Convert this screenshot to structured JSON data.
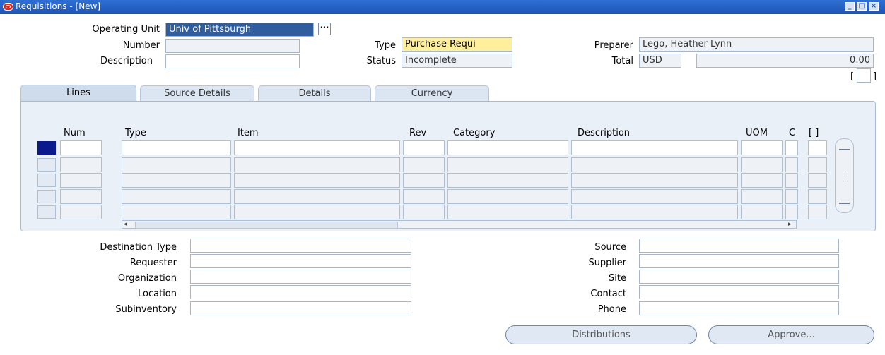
{
  "window": {
    "title": "Requisitions - [New]"
  },
  "header": {
    "operating_unit_label": "Operating Unit",
    "operating_unit_value": "Univ of Pittsburgh",
    "number_label": "Number",
    "number_value": "",
    "description_label": "Description",
    "description_value": "",
    "type_label": "Type",
    "type_value": "Purchase Requi",
    "status_label": "Status",
    "status_value": "Incomplete",
    "preparer_label": "Preparer",
    "preparer_value": "Lego, Heather Lynn",
    "total_label": "Total",
    "currency_value": "USD",
    "total_value": "0.00",
    "bracket_open": "[",
    "bracket_close": "]"
  },
  "tabs": [
    "Lines",
    "Source Details",
    "Details",
    "Currency"
  ],
  "lines": {
    "columns": [
      "Num",
      "Type",
      "Item",
      "Rev",
      "Category",
      "Description",
      "UOM",
      "C",
      "[ ]"
    ]
  },
  "detail": {
    "destination_type_label": "Destination Type",
    "requester_label": "Requester",
    "organization_label": "Organization",
    "location_label": "Location",
    "subinventory_label": "Subinventory",
    "source_label": "Source",
    "supplier_label": "Supplier",
    "site_label": "Site",
    "contact_label": "Contact",
    "phone_label": "Phone"
  },
  "buttons": {
    "distributions": "Distributions",
    "approve": "Approve..."
  }
}
